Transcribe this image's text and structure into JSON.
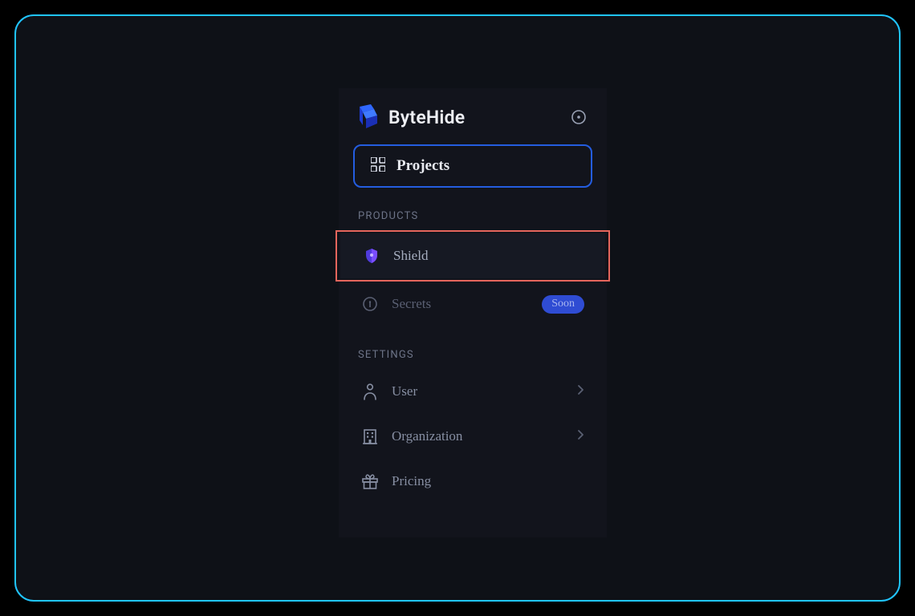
{
  "brand": {
    "name": "ByteHide"
  },
  "nav": {
    "projects_label": "Projects",
    "sections": {
      "products": {
        "title": "PRODUCTS",
        "shield_label": "Shield",
        "secrets_label": "Secrets",
        "secrets_badge": "Soon"
      },
      "settings": {
        "title": "SETTINGS",
        "user_label": "User",
        "organization_label": "Organization",
        "pricing_label": "Pricing"
      }
    }
  }
}
